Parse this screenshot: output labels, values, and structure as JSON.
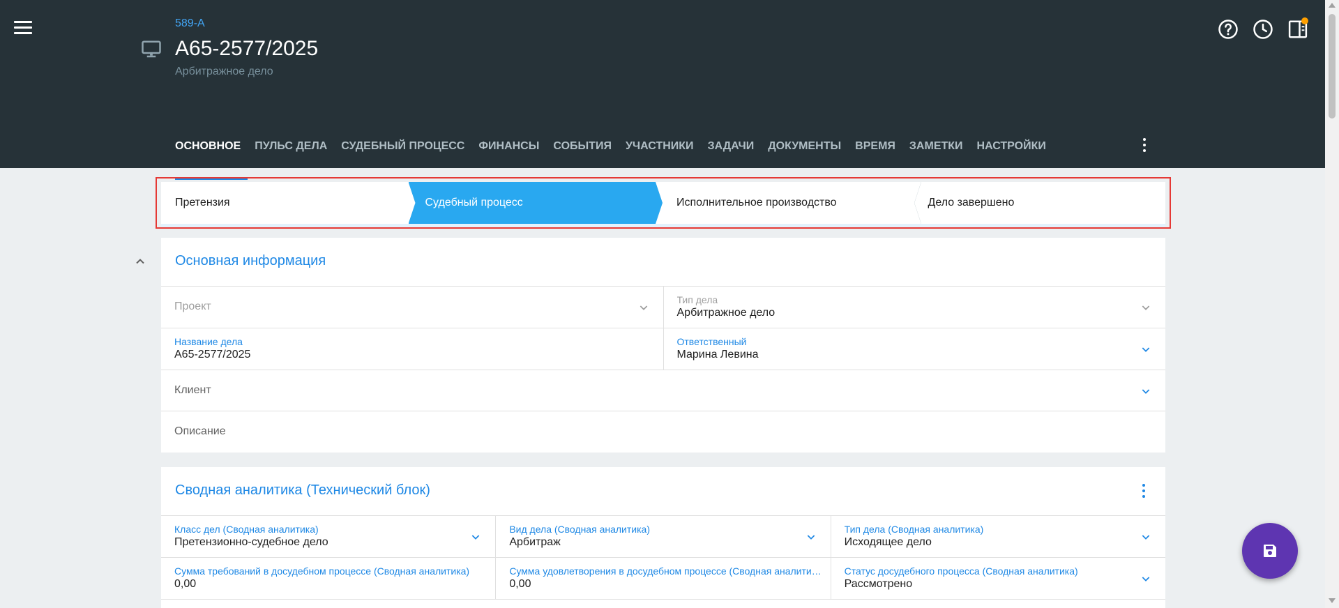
{
  "header": {
    "code": "589-A",
    "title": "А65-2577/2025",
    "subtitle": "Арбитражное дело",
    "icons": [
      "menu-icon",
      "monitor-icon",
      "help-icon",
      "clock-icon",
      "panel-icon"
    ],
    "notification_color": "#ffa000"
  },
  "tabs": [
    {
      "label": "ОСНОВНОЕ",
      "active": true
    },
    {
      "label": "ПУЛЬС ДЕЛА"
    },
    {
      "label": "СУДЕБНЫЙ ПРОЦЕСС"
    },
    {
      "label": "ФИНАНСЫ"
    },
    {
      "label": "СОБЫТИЯ"
    },
    {
      "label": "УЧАСТНИКИ"
    },
    {
      "label": "ЗАДАЧИ"
    },
    {
      "label": "ДОКУМЕНТЫ"
    },
    {
      "label": "ВРЕМЯ"
    },
    {
      "label": "ЗАМЕТКИ"
    },
    {
      "label": "НАСТРОЙКИ"
    }
  ],
  "stages": [
    {
      "label": "Претензия"
    },
    {
      "label": "Судебный процесс",
      "active": true
    },
    {
      "label": "Исполнительное производство"
    },
    {
      "label": "Дело завершено"
    }
  ],
  "basic_info": {
    "title": "Основная информация",
    "project": {
      "placeholder": "Проект"
    },
    "case_type": {
      "label": "Тип дела",
      "value": "Арбитражное дело"
    },
    "case_name": {
      "label": "Название дела",
      "value": "А65-2577/2025"
    },
    "responsible": {
      "label": "Ответственный",
      "value": "Марина Левина"
    },
    "client": {
      "placeholder": "Клиент"
    },
    "description": {
      "placeholder": "Описание"
    }
  },
  "analytics": {
    "title": "Сводная аналитика (Технический блок)",
    "class": {
      "label": "Класс дел (Сводная аналитика)",
      "value": "Претензионно-судебное дело"
    },
    "kind": {
      "label": "Вид дела (Сводная аналитика)",
      "value": "Арбитраж"
    },
    "type": {
      "label": "Тип дела (Сводная аналитика)",
      "value": "Исходящее дело"
    },
    "claims_sum": {
      "label": "Сумма требований в досудебном процессе (Сводная аналитика)",
      "value": "0,00"
    },
    "satisfied_sum": {
      "label": "Сумма удовлетворения в досудебном процессе (Сводная аналитика)",
      "value": "0,00"
    },
    "pretrial_status": {
      "label": "Статус досудебного процесса (Сводная аналитика)",
      "value": "Рассмотрено"
    }
  },
  "colors": {
    "header_bg": "#263238",
    "accent": "#1e88e5",
    "stage_active": "#29a8f0",
    "fab": "#5e35b1",
    "highlight_frame": "#e53935"
  }
}
